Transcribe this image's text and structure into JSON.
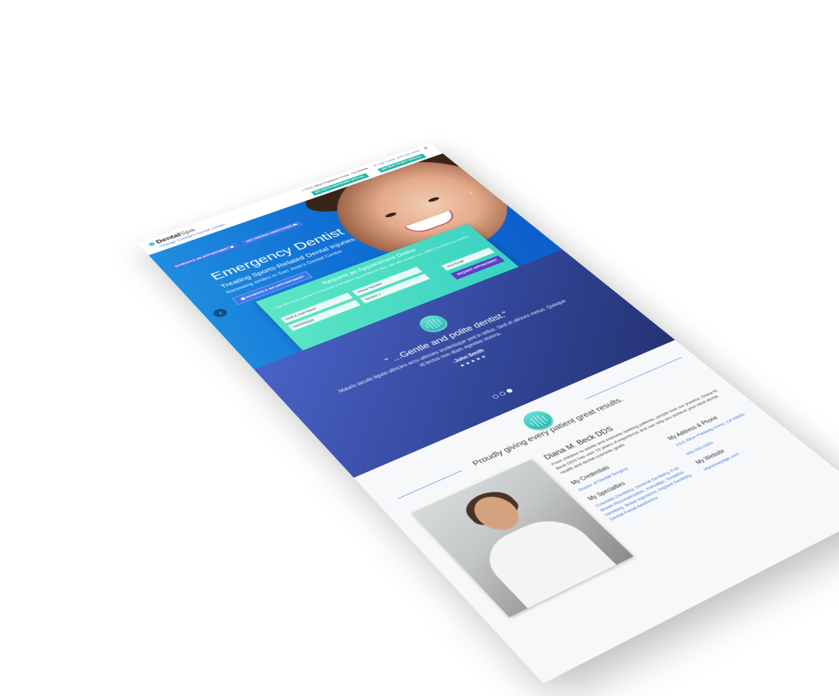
{
  "header": {
    "logo_brand": "Dental",
    "logo_accent": "Spa",
    "tagline": "Orange County's Dental Center",
    "address": "2121 Alton Parkway Irvine, CA 92606",
    "phone": "Call Today: 800-000-0000",
    "pill_whitening": "$39 TEETH WHITENING SPECIAL",
    "pill_new_patient": "$49 NEW PATIENT SPECIAL",
    "btn_schedule": "SCHEDULE AN APPOINTMENT",
    "btn_directions": "GET DRIVING DIRECTIONS"
  },
  "hero": {
    "title": "Emergency Dentist",
    "subtitle": "Treating Sports-Related Dental Injuries",
    "subtitle2": "Renewing smiles in San Jose's Dental Center",
    "button": "SCHEDULE AN APPOINTMENT"
  },
  "form": {
    "title": "Request an Appointment Online",
    "subtitle": "Use the form below to schedule a tentative appointment date. We will contact you within 24 hours to confirm.",
    "name_placeholder": "First & Last Name",
    "phone_placeholder": "Phone Number",
    "email_placeholder": "Your Email",
    "date_placeholder": "mm/dd/yyyy",
    "service_value": "Service 1",
    "submit": "REQUEST APPOINTMENT"
  },
  "testimonial": {
    "quote": "\" ...Gentle and polite dentist.\"",
    "body": "Mauris iaculis ligula ultricies arcu ultricies scelerisque sed in tellus. Sed ut ultrices metus. Quisque id lectus non diam egestas viverra.",
    "author": "-John Smith",
    "stars": "★★★★★"
  },
  "about": {
    "heading": "Proudly giving every patient great results.",
    "name": "Diana M. Beck DDS",
    "bio": "From children to adults and cosmetic seeking patients, people love our practice. Diana M. Beck DDS has over 15 years of experience and can help you achieve your ideal dental health and dental cosmetic goals.",
    "credentials_label": "My Credentials",
    "credentials": "Doctor of Dental Surgery",
    "specialties_label": "My Specialties",
    "specialties": "Cosmetic Dentistry, General Dentistry, Full-Mouth Reconstruction, Invisalign, Sedation Dentistry, Botox Injections, Implant Dentistry, Dental Facial Aesthetics",
    "address_label": "My Address & Phone",
    "address": "2121 Alton Parkway Irvine, CA 92606",
    "phone": "000-000-0000",
    "website_label": "My Website",
    "website": "Myhomepage.com"
  },
  "colors": {
    "primary": "#3f76e8",
    "teal": "#38d1c2",
    "purple": "#5b3fc4",
    "navy": "#33479a"
  }
}
